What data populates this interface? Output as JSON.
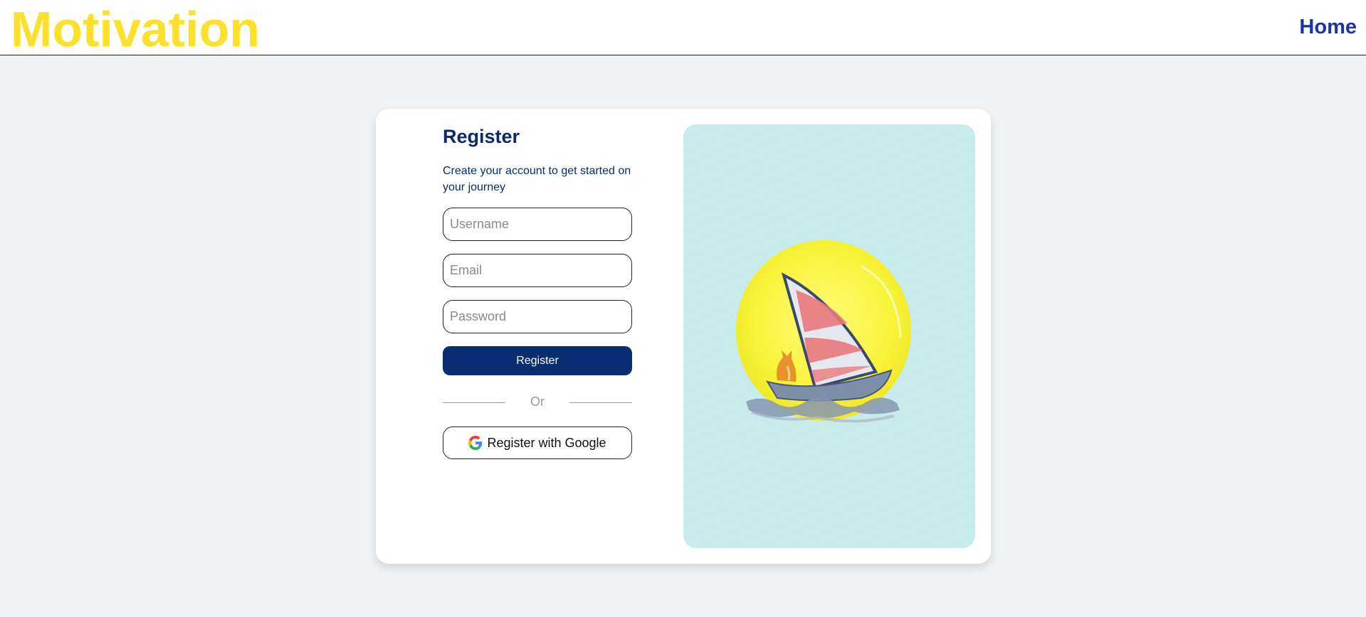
{
  "header": {
    "brand": "Motivation",
    "nav_home": "Home"
  },
  "register": {
    "title": "Register",
    "subtitle": "Create your account to get started on your journey",
    "username_placeholder": "Username",
    "email_placeholder": "Email",
    "password_placeholder": "Password",
    "submit_label": "Register",
    "divider_text": "Or",
    "google_label": "Register with Google"
  },
  "illustration": {
    "icon": "sailboat-moon-illustration",
    "background_color": "#c8ecec",
    "moon_color": "#fbf339",
    "sail_stripe_color": "#e8797c"
  },
  "colors": {
    "brand": "#fde02b",
    "nav": "#1c33a8",
    "heading": "#0b2a6b",
    "primary_button": "#082d73",
    "page_background": "#f1f3f5"
  }
}
